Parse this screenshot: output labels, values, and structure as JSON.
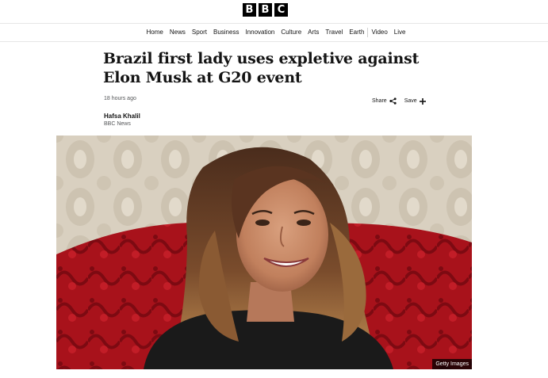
{
  "header": {
    "logo_letters": [
      "B",
      "B",
      "C"
    ]
  },
  "nav": {
    "items": [
      "Home",
      "News",
      "Sport",
      "Business",
      "Innovation",
      "Culture",
      "Arts",
      "Travel",
      "Earth"
    ],
    "items_after_divider": [
      "Video",
      "Live"
    ]
  },
  "article": {
    "headline": "Brazil first lady uses expletive against Elon Musk at G20 event",
    "timestamp": "18 hours ago",
    "share_label": "Share",
    "save_label": "Save",
    "author": "Hafsa Khalil",
    "author_org": "BBC News",
    "image": {
      "credit": "Getty Images",
      "description_icon": "portrait-photo"
    }
  },
  "colors": {
    "text": "#141414",
    "muted": "#545658",
    "logo_bg": "#000000",
    "chair_red": "#b3121c",
    "wall_beige": "#d7cfc0"
  }
}
